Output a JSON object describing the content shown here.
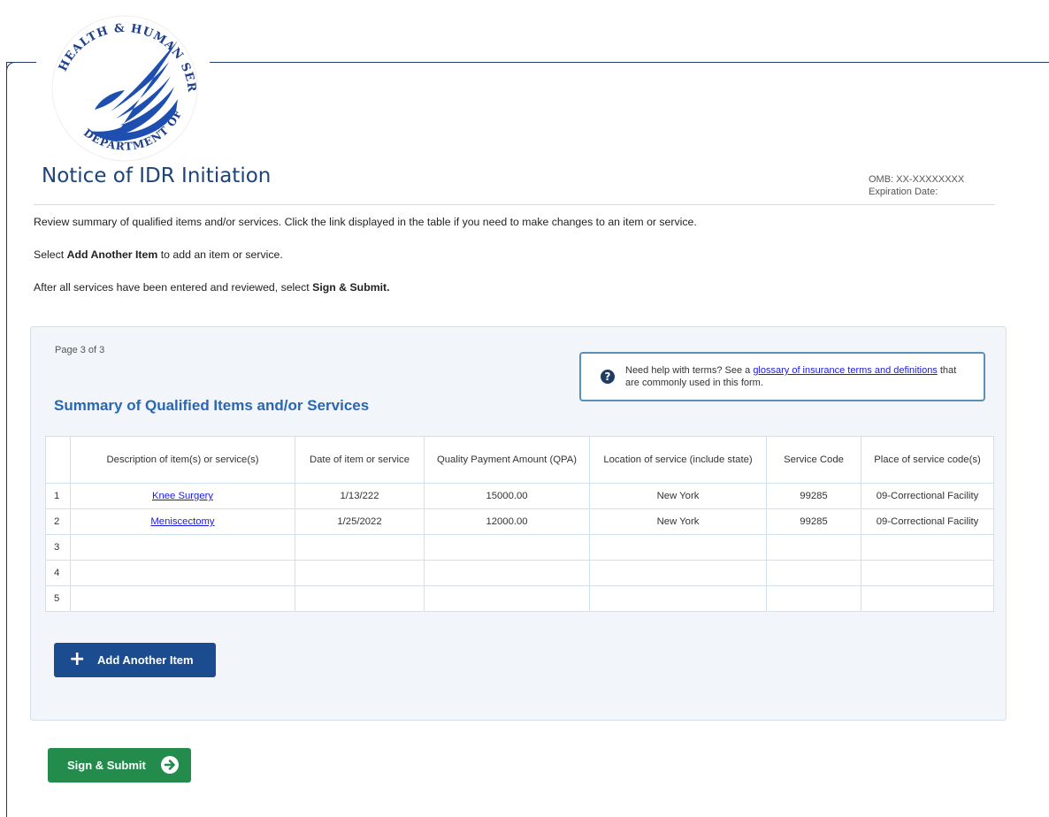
{
  "agency": {
    "seal_text_top": "HUMAN SERVICES·USA",
    "seal_text_left": "HEALTH &",
    "seal_text_bottom": "DEPARTMENT OF"
  },
  "header": {
    "title": "Notice of IDR Initiation",
    "omb": "OMB: XX-XXXXXXXX",
    "expiration": "Expiration Date:"
  },
  "instructions": {
    "line1": "Review summary of qualified items and/or services. Click the link displayed in the table if you need to make changes to an item or service.",
    "line2_prefix": "Select ",
    "line2_bold": "Add Another Item",
    "line2_suffix": " to add an item or service.",
    "line3_prefix": "After all services have been entered and reviewed, select ",
    "line3_bold": "Sign & Submit."
  },
  "panel": {
    "page_indicator": "Page 3 of 3",
    "help": {
      "icon": "question-circle-icon",
      "prefix": "Need help with terms? See a ",
      "link": "glossary of insurance terms and definitions",
      "suffix": " that are commonly used in this form."
    },
    "heading": "Summary of Qualified Items and/or Services"
  },
  "table": {
    "headers": [
      "",
      "Description of item(s) or service(s)",
      "Date of item or service",
      "Quality Payment Amount (QPA)",
      "Location of service (include state)",
      "Service Code",
      "Place of service code(s)"
    ],
    "rows": [
      {
        "num": "1",
        "description": "Knee Surgery",
        "date": "1/13/222",
        "qpa": "15000.00",
        "location": "New York",
        "code": "99285",
        "place": "09-Correctional Facility"
      },
      {
        "num": "2",
        "description": "Meniscectomy",
        "date": "1/25/2022",
        "qpa": "12000.00",
        "location": "New York",
        "code": "99285",
        "place": "09-Correctional Facility"
      },
      {
        "num": "3",
        "description": "",
        "date": "",
        "qpa": "",
        "location": "",
        "code": "",
        "place": ""
      },
      {
        "num": "4",
        "description": "",
        "date": "",
        "qpa": "",
        "location": "",
        "code": "",
        "place": ""
      },
      {
        "num": "5",
        "description": "",
        "date": "",
        "qpa": "",
        "location": "",
        "code": "",
        "place": ""
      }
    ]
  },
  "buttons": {
    "add_item": "Add Another Item",
    "add_icon": "plus-icon",
    "submit": "Sign & Submit",
    "submit_icon": "arrow-right-circle-icon"
  },
  "colors": {
    "brand_blue": "#1b4c8f",
    "heading_blue": "#2a67b2",
    "submit_green": "#238c4c",
    "link": "#1a1ae6"
  }
}
